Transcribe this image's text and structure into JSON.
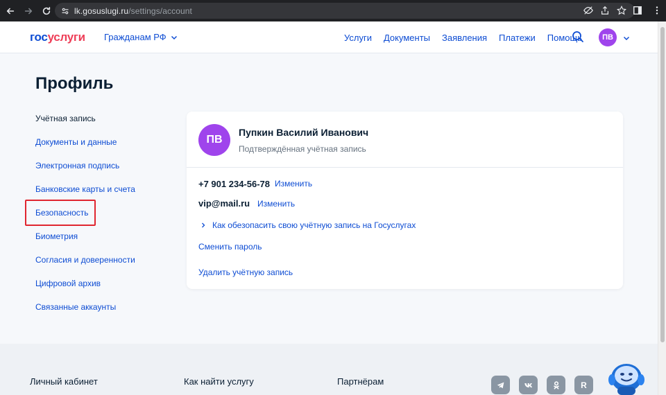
{
  "browser": {
    "url_host": "lk.gosuslugi.ru",
    "url_path": "/settings/account"
  },
  "header": {
    "logo_part1": "гос",
    "logo_part2": "услуги",
    "region": "Гражданам РФ",
    "nav": [
      "Услуги",
      "Документы",
      "Заявления",
      "Платежи",
      "Помощь"
    ],
    "avatar_initials": "ПВ"
  },
  "page": {
    "title": "Профиль"
  },
  "sidebar": {
    "items": [
      "Учётная запись",
      "Документы и данные",
      "Электронная подпись",
      "Банковские карты и счета",
      "Безопасность",
      "Биометрия",
      "Согласия и доверенности",
      "Цифровой архив",
      "Связанные аккаунты"
    ]
  },
  "profile": {
    "initials": "ПВ",
    "name": "Пупкин Василий Иванович",
    "status": "Подтверждённая учётная запись",
    "phone": "+7 901 234-56-78",
    "phone_change": "Изменить",
    "email": "vip@mail.ru",
    "email_change": "Изменить",
    "secure_link": "Как обезопасить свою учётную запись на Госуслугах",
    "change_password": "Сменить пароль",
    "delete_account": "Удалить учётную запись"
  },
  "footer": {
    "columns": [
      "Личный кабинет",
      "Как найти услугу",
      "Партнёрам"
    ],
    "social": [
      "telegram-icon",
      "vk-icon",
      "ok-icon",
      "rutube-icon"
    ],
    "rutube_letter": "R"
  },
  "colors": {
    "link": "#0d4cd3",
    "text": "#0b1f33",
    "avatar": "#9f44ec",
    "highlight": "#e0252f",
    "logo_red": "#ee3f58"
  }
}
